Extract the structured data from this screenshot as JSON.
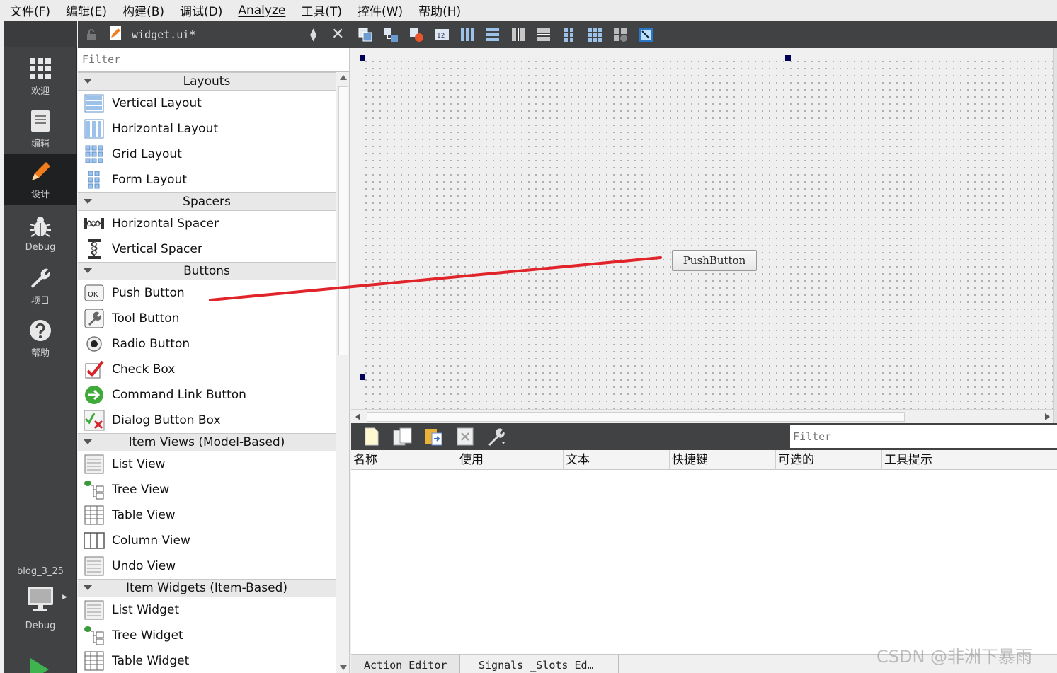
{
  "menu": [
    "文件(F)",
    "编辑(E)",
    "构建(B)",
    "调试(D)",
    "Analyze",
    "工具(T)",
    "控件(W)",
    "帮助(H)"
  ],
  "modes": [
    {
      "label": "欢迎",
      "icon": "grid-icon"
    },
    {
      "label": "编辑",
      "icon": "document-icon"
    },
    {
      "label": "设计",
      "icon": "pencil-icon"
    },
    {
      "label": "Debug",
      "icon": "bug-icon"
    },
    {
      "label": "项目",
      "icon": "wrench-icon"
    },
    {
      "label": "帮助",
      "icon": "help-icon"
    }
  ],
  "project": {
    "name": "blog_3_25",
    "build": "Debug"
  },
  "file": {
    "name": "widget.ui*"
  },
  "widgetbox": {
    "filter_placeholder": "Filter",
    "categories": [
      {
        "title": "Layouts",
        "items": [
          "Vertical Layout",
          "Horizontal Layout",
          "Grid Layout",
          "Form Layout"
        ]
      },
      {
        "title": "Spacers",
        "items": [
          "Horizontal Spacer",
          "Vertical Spacer"
        ]
      },
      {
        "title": "Buttons",
        "items": [
          "Push Button",
          "Tool Button",
          "Radio Button",
          "Check Box",
          "Command Link Button",
          "Dialog Button Box"
        ]
      },
      {
        "title": "Item Views (Model-Based)",
        "items": [
          "List View",
          "Tree View",
          "Table View",
          "Column View",
          "Undo View"
        ]
      },
      {
        "title": "Item Widgets (Item-Based)",
        "items": [
          "List Widget",
          "Tree Widget",
          "Table Widget"
        ]
      }
    ]
  },
  "form": {
    "button_text": "PushButton"
  },
  "action_editor": {
    "filter_placeholder": "Filter",
    "columns": [
      "名称",
      "使用",
      "文本",
      "快捷键",
      "可选的",
      "工具提示"
    ]
  },
  "tabs": [
    "Action Editor",
    "Signals _Slots Ed…"
  ],
  "watermark": "CSDN @非洲下暴雨",
  "colors": {
    "annotation": "#e0242a",
    "dark_panel": "#404244"
  }
}
